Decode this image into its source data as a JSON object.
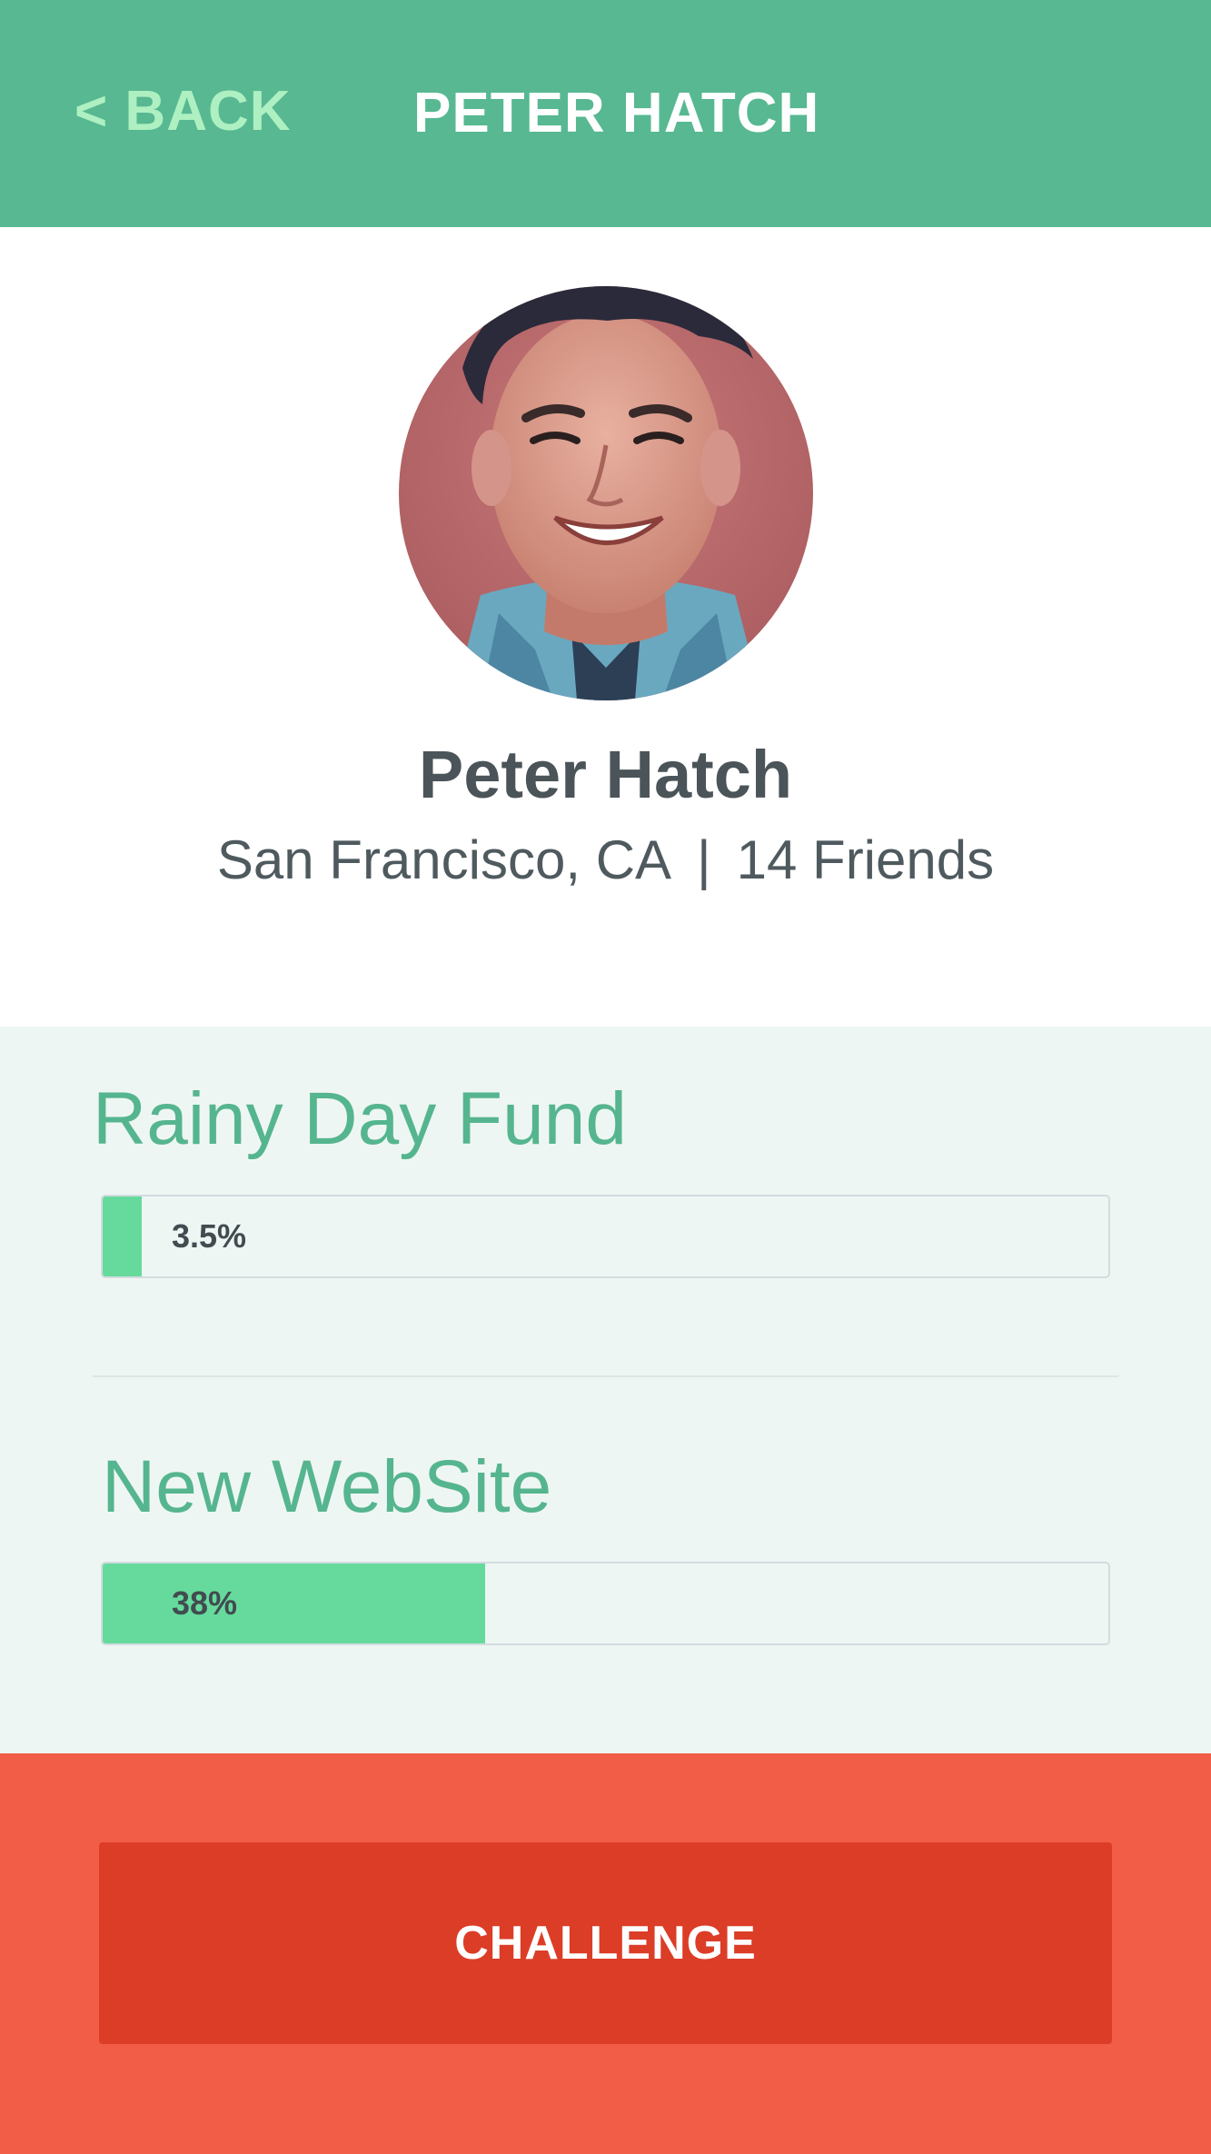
{
  "header": {
    "back_label": "< BACK",
    "title": "PETER HATCH"
  },
  "profile": {
    "name": "Peter Hatch",
    "location": "San Francisco, CA",
    "separator": "|",
    "friends": "14 Friends"
  },
  "goals": [
    {
      "title": "Rainy Day Fund",
      "progress_label": "3.5%",
      "progress_fraction": 0.035
    },
    {
      "title": "New WebSite",
      "progress_label": "38%",
      "progress_fraction": 0.38
    }
  ],
  "footer": {
    "challenge_label": "CHALLENGE"
  },
  "colors": {
    "header_bg": "#57b891",
    "back_text": "#aef0c1",
    "accent_green": "#55b58f",
    "progress_fill": "#66da9c",
    "goals_bg": "#eef6f3",
    "footer_bg": "#f15d47",
    "challenge_bg": "#dc3d27"
  }
}
